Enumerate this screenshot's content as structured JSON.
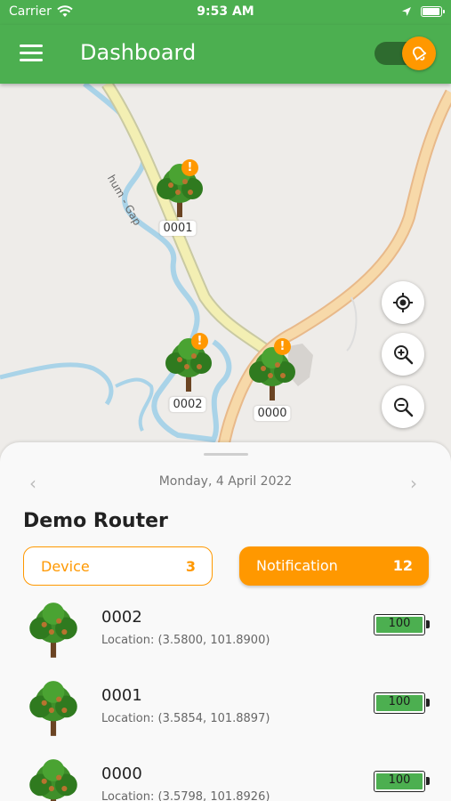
{
  "status_bar": {
    "carrier": "Carrier",
    "time": "9:53 AM",
    "battery_level": 0.95
  },
  "app_bar": {
    "title": "Dashboard",
    "alert_toggle_on": true
  },
  "map": {
    "road_label": "hum - Gap",
    "markers": [
      {
        "id": "0001",
        "alert": "!"
      },
      {
        "id": "0002",
        "alert": "!"
      },
      {
        "id": "0000",
        "alert": "!"
      }
    ],
    "buttons": [
      "my-location-icon",
      "zoom-in-icon",
      "zoom-out-icon"
    ]
  },
  "sheet": {
    "prev": "‹",
    "next": "›",
    "date": "Monday, 4 April 2022",
    "router_name": "Demo Router",
    "tabs": {
      "device": {
        "label": "Device",
        "count": "3"
      },
      "notification": {
        "label": "Notification",
        "count": "12"
      }
    },
    "devices": [
      {
        "id": "0002",
        "location": "Location: (3.5800, 101.8900)",
        "battery": "100"
      },
      {
        "id": "0001",
        "location": "Location: (3.5854, 101.8897)",
        "battery": "100"
      },
      {
        "id": "0000",
        "location": "Location: (3.5798, 101.8926)",
        "battery": "100"
      }
    ]
  },
  "colors": {
    "primary": "#4caf50",
    "accent": "#ff9800"
  }
}
